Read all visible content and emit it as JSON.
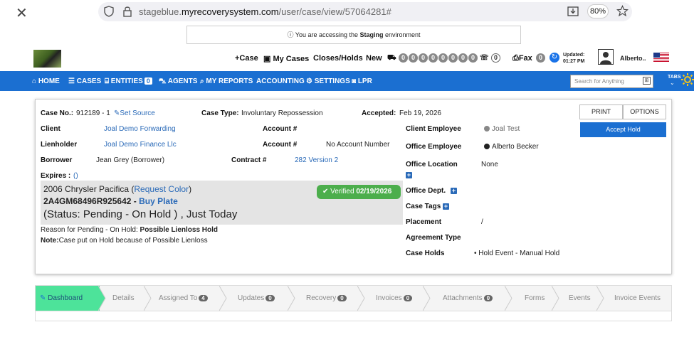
{
  "browser": {
    "url_prefix": "stageblue.",
    "url_domain": "myrecoverysystem.com",
    "url_path": "/user/case/view/57064281#",
    "zoom": "80%"
  },
  "notice": {
    "pre": "You are accessing the ",
    "env": "Staging",
    "post": " environment"
  },
  "header": {
    "case_link": "+Case",
    "my_cases": "My Cases",
    "closes_holds": "Closes/Holds",
    "new": "New",
    "new_counts": [
      "0",
      "0",
      "0",
      "0",
      "0",
      "0",
      "0",
      "0"
    ],
    "phone_count": "0",
    "fax": "Fax",
    "fax_count": "0",
    "updated_label": "Updated:",
    "updated_time": "01:27 PM",
    "user": "Alberto.."
  },
  "nav": {
    "home": "HOME",
    "cases": "CASES",
    "entities": "ENTITIES",
    "entities_count": "0",
    "agents": "AGENTS",
    "my_reports": "MY REPORTS",
    "accounting": "ACCOUNTING",
    "settings": "SETTINGS",
    "lpr": "LPR",
    "search_placeholder": "Search for Anything",
    "tabs": "TABS"
  },
  "case": {
    "case_no_label": "Case No.:",
    "case_no": "912189 - 1",
    "set_source": "Set Source",
    "case_type_label": "Case Type:",
    "case_type": "Involuntary Repossession",
    "accepted_label": "Accepted:",
    "accepted": "Feb 19, 2026",
    "client_label": "Client",
    "client": "Joal Demo Forwarding",
    "account_label": "Account #",
    "account_1": "",
    "lienholder_label": "Lienholder",
    "lienholder": "Joal Demo Finance Llc",
    "account_label_2": "Account #",
    "account_2": "No Account Number",
    "borrower_label": "Borrower",
    "borrower": "Jean Grey (Borrower)",
    "contract_label": "Contract #",
    "contract": "282 Version 2",
    "expires_label": "Expires :",
    "expires": "()",
    "vehicle": "2006 Chrysler Pacifica (",
    "request_color": "Request Color",
    "vehicle_close": ")",
    "vin": "2A4GM68496R925642",
    "vin_sep": " - ",
    "buy_plate": "Buy Plate",
    "status": "(Status: Pending - On Hold ) , Just Today",
    "verified_label": "Verified",
    "verified_date": "02/19/2026",
    "reason_label": "Reason for Pending - On Hold:",
    "reason": "Possible Lienloss Hold",
    "note_label": "Note:",
    "note": "Case put on Hold because of Possible Lienloss",
    "client_employee_label": "Client Employee",
    "client_employee": "Joal Test",
    "office_employee_label": "Office Employee",
    "office_employee": "Alberto Becker",
    "office_location_label": "Office Location",
    "office_location": "None",
    "office_dept_label": "Office Dept.",
    "case_tags_label": "Case Tags",
    "placement_label": "Placement",
    "placement": "/",
    "agreement_type_label": "Agreement Type",
    "case_holds_label": "Case Holds",
    "case_holds": "Hold Event - Manual Hold",
    "print": "PRINT",
    "options": "OPTIONS",
    "accept_hold": "Accept Hold"
  },
  "tabs": [
    {
      "label": "Dashboard",
      "count": ""
    },
    {
      "label": "Details",
      "count": ""
    },
    {
      "label": "Assigned To",
      "count": "4"
    },
    {
      "label": "Updates",
      "count": "0"
    },
    {
      "label": "Recovery",
      "count": "0"
    },
    {
      "label": "Invoices",
      "count": "0"
    },
    {
      "label": "Attachments",
      "count": "0"
    },
    {
      "label": "Forms",
      "count": ""
    },
    {
      "label": "Events",
      "count": ""
    },
    {
      "label": "Invoice Events",
      "count": ""
    }
  ],
  "colors": {
    "nav_blue": "#1b6fd1",
    "link_blue": "#2a6ab8",
    "verified_green": "#4cae4c",
    "dashboard_tab": "#4de39a"
  }
}
